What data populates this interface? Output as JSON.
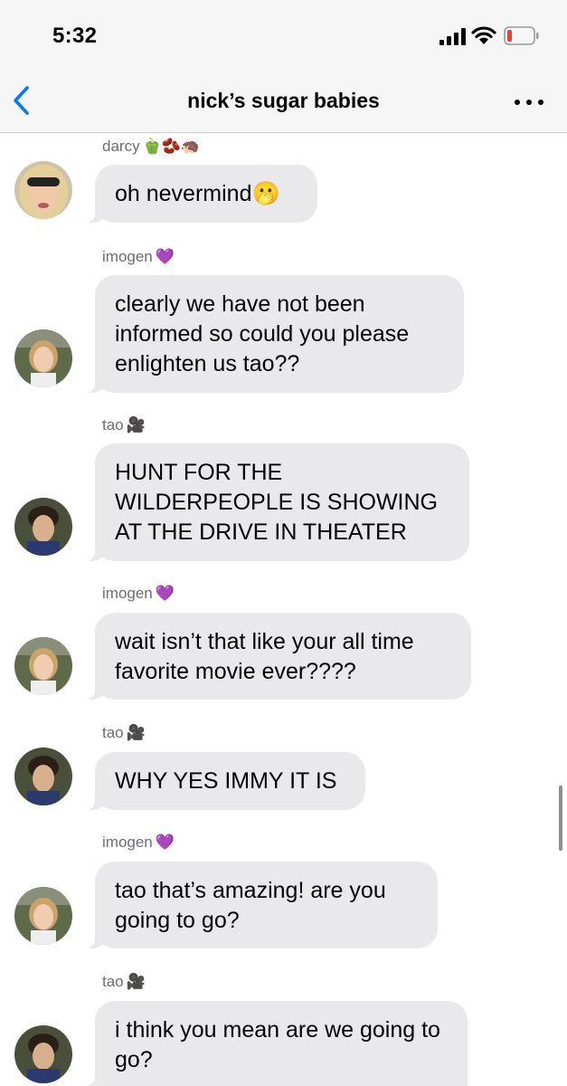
{
  "status_bar": {
    "time": "5:32",
    "battery_color": "#ff3b30",
    "icons": [
      "cellular-signal-icon",
      "wifi-icon",
      "battery-low-icon"
    ]
  },
  "nav": {
    "title": "nick’s sugar babies",
    "accent_color": "#007aff",
    "icons": [
      "back-chevron-icon",
      "more-options-icon"
    ]
  },
  "messages": [
    {
      "sender": "darcy",
      "sender_emoji": "🫑🫘🦔",
      "text": "oh nevermind🫢"
    },
    {
      "sender": "imogen",
      "sender_emoji": "💜",
      "text": "clearly we have not been informed so could you please enlighten us tao??"
    },
    {
      "sender": "tao",
      "sender_emoji": "🎥",
      "text": "HUNT FOR THE WILDERPEOPLE IS SHOWING AT THE DRIVE IN THEATER"
    },
    {
      "sender": "imogen",
      "sender_emoji": "💜",
      "text": "wait isn’t that like your all time favorite movie ever????"
    },
    {
      "sender": "tao",
      "sender_emoji": "🎥",
      "text": "WHY YES IMMY IT IS"
    },
    {
      "sender": "imogen",
      "sender_emoji": "💜",
      "text": "tao that’s amazing! are you going to go?"
    },
    {
      "sender": "tao",
      "sender_emoji": "🎥",
      "text": "i think you mean are we going to go?"
    }
  ]
}
